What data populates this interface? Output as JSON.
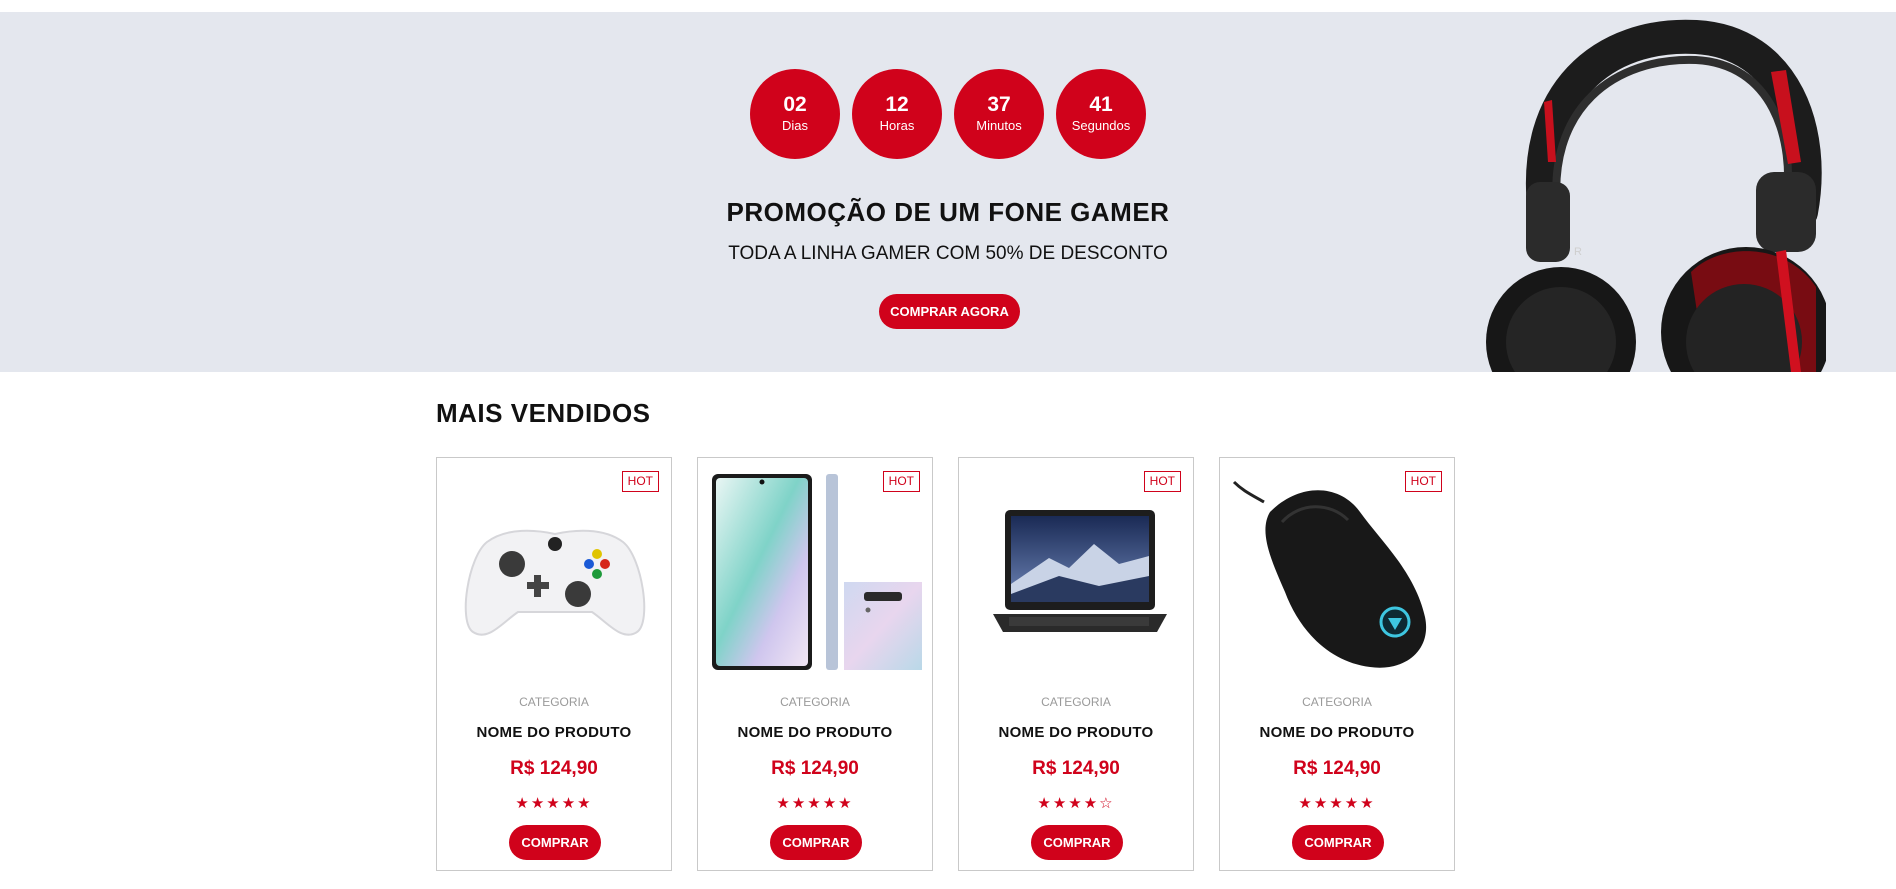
{
  "countdown": [
    {
      "value": "02",
      "label": "Dias"
    },
    {
      "value": "12",
      "label": "Horas"
    },
    {
      "value": "37",
      "label": "Minutos"
    },
    {
      "value": "41",
      "label": "Segundos"
    }
  ],
  "promo": {
    "title": "PROMOÇÃO DE UM FONE GAMER",
    "subtitle": "TODA A LINHA GAMER COM 50% DE DESCONTO",
    "button": "COMPRAR AGORA"
  },
  "section_title": "MAIS VENDIDOS",
  "products": [
    {
      "badge": "HOT",
      "category": "CATEGORIA",
      "name": "NOME DO PRODUTO",
      "price": "R$ 124,90",
      "stars": "★★★★★",
      "rating": 5,
      "button": "COMPRAR",
      "image": "game-controller"
    },
    {
      "badge": "HOT",
      "category": "CATEGORIA",
      "name": "NOME DO PRODUTO",
      "price": "R$ 124,90",
      "stars": "★★★★★",
      "rating": 5,
      "button": "COMPRAR",
      "image": "smartphone"
    },
    {
      "badge": "HOT",
      "category": "CATEGORIA",
      "name": "NOME DO PRODUTO",
      "price": "R$ 124,90",
      "stars": "★★★★☆",
      "rating": 4,
      "button": "COMPRAR",
      "image": "laptop"
    },
    {
      "badge": "HOT",
      "category": "CATEGORIA",
      "name": "NOME DO PRODUTO",
      "price": "R$ 124,90",
      "stars": "★★★★★",
      "rating": 5,
      "button": "COMPRAR",
      "image": "gaming-mouse"
    }
  ],
  "colors": {
    "accent": "#d0021b",
    "banner_bg": "#e4e7ee"
  }
}
